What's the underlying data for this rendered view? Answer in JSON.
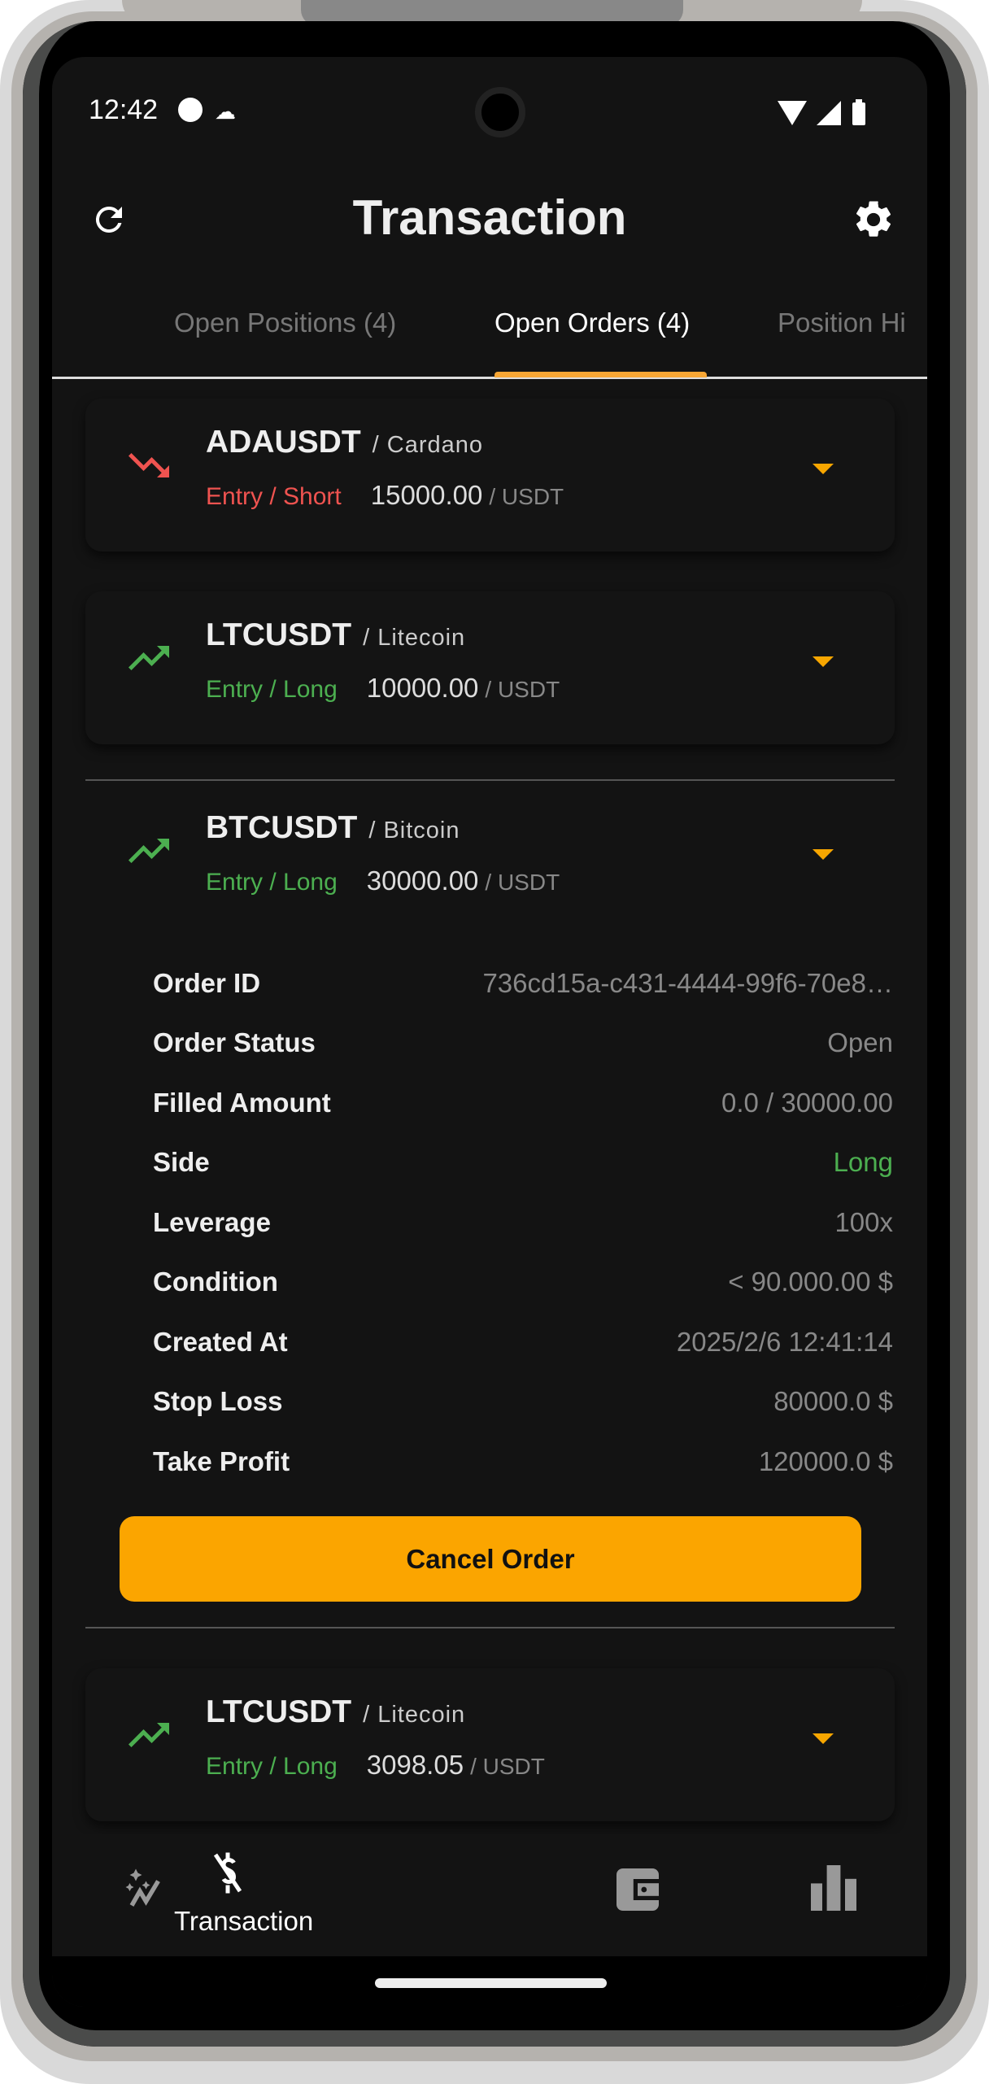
{
  "status_bar": {
    "time": "12:42"
  },
  "app_bar": {
    "title": "Transaction"
  },
  "tabs": [
    {
      "label": "Open Positions (4)"
    },
    {
      "label": "Open Orders (4)"
    },
    {
      "label": "Position Hi"
    }
  ],
  "orders": [
    {
      "symbol": "ADAUSDT",
      "name": "/ Cardano",
      "type": "Entry / Short",
      "amount": "15000.00",
      "unit": "/ USDT",
      "direction": "down"
    },
    {
      "symbol": "LTCUSDT",
      "name": "/ Litecoin",
      "type": "Entry / Long",
      "amount": "10000.00",
      "unit": "/ USDT",
      "direction": "up"
    },
    {
      "symbol": "BTCUSDT",
      "name": "/ Bitcoin",
      "type": "Entry / Long",
      "amount": "30000.00",
      "unit": "/ USDT",
      "direction": "up"
    },
    {
      "symbol": "LTCUSDT",
      "name": "/ Litecoin",
      "type": "Entry / Long",
      "amount": "3098.05",
      "unit": "/ USDT",
      "direction": "up"
    }
  ],
  "details": [
    {
      "label": "Order ID",
      "value": "736cd15a-c431-4444-99f6-70e8…"
    },
    {
      "label": "Order Status",
      "value": "Open"
    },
    {
      "label": "Filled Amount",
      "value": "0.0 / 30000.00"
    },
    {
      "label": "Side",
      "value": "Long"
    },
    {
      "label": "Leverage",
      "value": "100x"
    },
    {
      "label": "Condition",
      "value": "< 90.000.00 $"
    },
    {
      "label": "Created At",
      "value": "2025/2/6 12:41:14"
    },
    {
      "label": "Stop Loss",
      "value": "80000.0 $"
    },
    {
      "label": "Take Profit",
      "value": "120000.0 $"
    }
  ],
  "cancel_label": "Cancel Order",
  "bottom_nav": {
    "active_label": "Transaction"
  },
  "colors": {
    "accent": "#fba500",
    "long": "#4caf50",
    "short": "#ef5350"
  }
}
